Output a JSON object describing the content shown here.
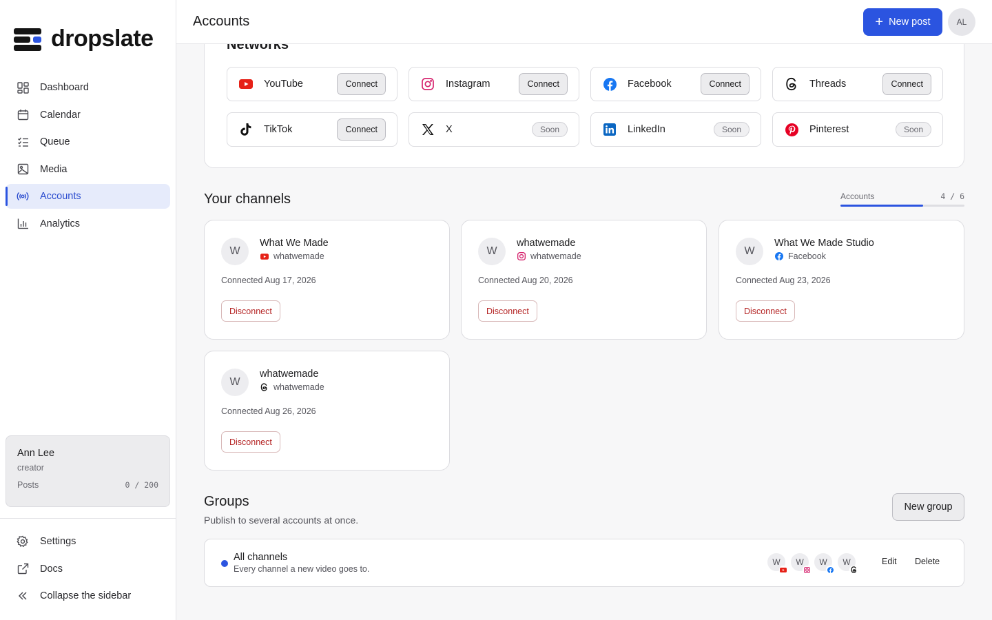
{
  "app": {
    "brand": "dropslate",
    "accent": "#2b54e0"
  },
  "sidebar": {
    "items": [
      {
        "label": "Dashboard",
        "icon": "grid-icon"
      },
      {
        "label": "Calendar",
        "icon": "calendar-icon"
      },
      {
        "label": "Queue",
        "icon": "list-check-icon"
      },
      {
        "label": "Media",
        "icon": "image-icon"
      },
      {
        "label": "Accounts",
        "icon": "broadcast-icon",
        "active": true
      },
      {
        "label": "Analytics",
        "icon": "bar-chart-icon"
      }
    ],
    "user": {
      "name": "Ann Lee",
      "role": "creator",
      "posts_label": "Posts",
      "posts_value": "0 / 200"
    },
    "bottom": [
      {
        "label": "Settings",
        "icon": "gear-icon"
      },
      {
        "label": "Docs",
        "icon": "external-link-icon"
      },
      {
        "label": "Collapse the sidebar",
        "icon": "chevrons-left-icon"
      }
    ]
  },
  "header": {
    "title": "Accounts",
    "new_post": "New post",
    "avatar_initials": "AL"
  },
  "networks": {
    "title": "Networks",
    "connect_label": "Connect",
    "soon_label": "Soon",
    "items": [
      {
        "name": "YouTube",
        "icon": "youtube-icon",
        "state": "connect"
      },
      {
        "name": "Instagram",
        "icon": "instagram-icon",
        "state": "connect"
      },
      {
        "name": "Facebook",
        "icon": "facebook-icon",
        "state": "connect"
      },
      {
        "name": "Threads",
        "icon": "threads-icon",
        "state": "connect"
      },
      {
        "name": "TikTok",
        "icon": "tiktok-icon",
        "state": "connect"
      },
      {
        "name": "X",
        "icon": "x-icon",
        "state": "soon"
      },
      {
        "name": "LinkedIn",
        "icon": "linkedin-icon",
        "state": "soon"
      },
      {
        "name": "Pinterest",
        "icon": "pinterest-icon",
        "state": "soon"
      }
    ]
  },
  "channels": {
    "title": "Your channels",
    "usage_label": "Accounts",
    "usage_text": "4 / 6",
    "usage_fraction": 0.6667,
    "disconnect_label": "Disconnect",
    "items": [
      {
        "initial": "W",
        "name": "What We Made",
        "network_icon": "youtube-icon",
        "handle": "whatwemade",
        "connected": "Connected Aug 17, 2026"
      },
      {
        "initial": "W",
        "name": "whatwemade",
        "network_icon": "instagram-icon",
        "handle": "whatwemade",
        "connected": "Connected Aug 20, 2026"
      },
      {
        "initial": "W",
        "name": "What We Made Studio",
        "network_icon": "facebook-icon",
        "handle": "Facebook",
        "connected": "Connected Aug 23, 2026"
      },
      {
        "initial": "W",
        "name": "whatwemade",
        "network_icon": "threads-icon",
        "handle": "whatwemade",
        "connected": "Connected Aug 26, 2026"
      }
    ]
  },
  "groups": {
    "title": "Groups",
    "subtitle": "Publish to several accounts at once.",
    "new_group": "New group",
    "items": [
      {
        "name": "All channels",
        "description": "Every channel a new video goes to.",
        "members": [
          {
            "initial": "W",
            "icon": "youtube-icon"
          },
          {
            "initial": "W",
            "icon": "instagram-icon"
          },
          {
            "initial": "W",
            "icon": "facebook-icon"
          },
          {
            "initial": "W",
            "icon": "threads-icon"
          }
        ],
        "edit": "Edit",
        "delete": "Delete"
      }
    ]
  }
}
